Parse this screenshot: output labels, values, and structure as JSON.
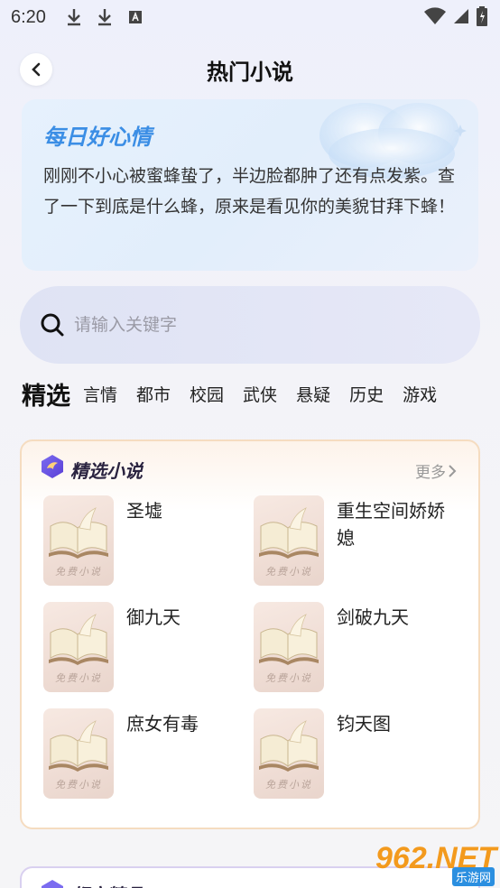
{
  "status": {
    "time": "6:20"
  },
  "header": {
    "title": "热门小说"
  },
  "mood": {
    "title": "每日好心情",
    "text": "刚刚不小心被蜜蜂蛰了，半边脸都肿了还有点发紫。查了一下到底是什么蜂，原来是看见你的美貌甘拜下蜂！"
  },
  "search": {
    "placeholder": "请输入关键字"
  },
  "tabs": {
    "active": "精选",
    "items": [
      "言情",
      "都市",
      "校园",
      "武侠",
      "悬疑",
      "历史",
      "游戏"
    ]
  },
  "featured": {
    "title": "精选小说",
    "more": "更多",
    "cover_label": "免费小说",
    "books": [
      "圣墟",
      "重生空间娇娇媳",
      "御九天",
      "剑破九天",
      "庶女有毒",
      "钧天图"
    ]
  },
  "next_section": {
    "title": "都市精品"
  },
  "watermark": {
    "brand": "962.NET",
    "sub": "乐游网"
  },
  "colors": {
    "accent": "#3b8ee5",
    "panel_border": "#f5dcc0",
    "search_bg": "#dfe3f4"
  }
}
